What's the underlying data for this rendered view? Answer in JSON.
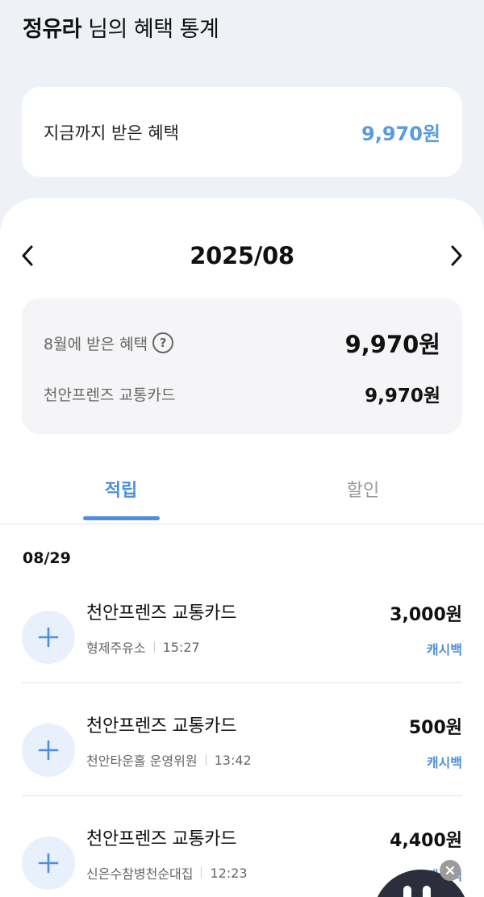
{
  "header": {
    "user_name": "정유라",
    "title_suffix": " 님의 혜택 통계"
  },
  "total": {
    "label": "지금까지 받은 혜택",
    "value": "9,970원"
  },
  "month_nav": {
    "month": "2025/08"
  },
  "month_summary": {
    "benefit_label": "8월에 받은 혜택",
    "help_glyph": "?",
    "benefit_value": "9,970원",
    "card_label": "천안프렌즈 교통카드",
    "card_value": "9,970원"
  },
  "tabs": {
    "earn": "적립",
    "discount": "할인"
  },
  "date_group": "08/29",
  "transactions": [
    {
      "merchant": "천안프렌즈 교통카드",
      "place": "형제주유소",
      "time": "15:27",
      "amount": "3,000원",
      "type": "캐시백"
    },
    {
      "merchant": "천안프렌즈 교통카드",
      "place": "천안타운홀 운영위원",
      "time": "13:42",
      "amount": "500원",
      "type": "캐시백"
    },
    {
      "merchant": "천안프렌즈 교통카드",
      "place": "신은수참병천순대집",
      "time": "12:23",
      "amount": "4,400원",
      "type": "캐시백"
    }
  ],
  "colors": {
    "accent": "#4d8fdc",
    "total_value": "#5a9be0",
    "background": "#eef1f6"
  },
  "icons": {
    "prev": "chevron-left-icon",
    "next": "chevron-right-icon",
    "plus": "plus-icon",
    "close": "close-icon"
  }
}
